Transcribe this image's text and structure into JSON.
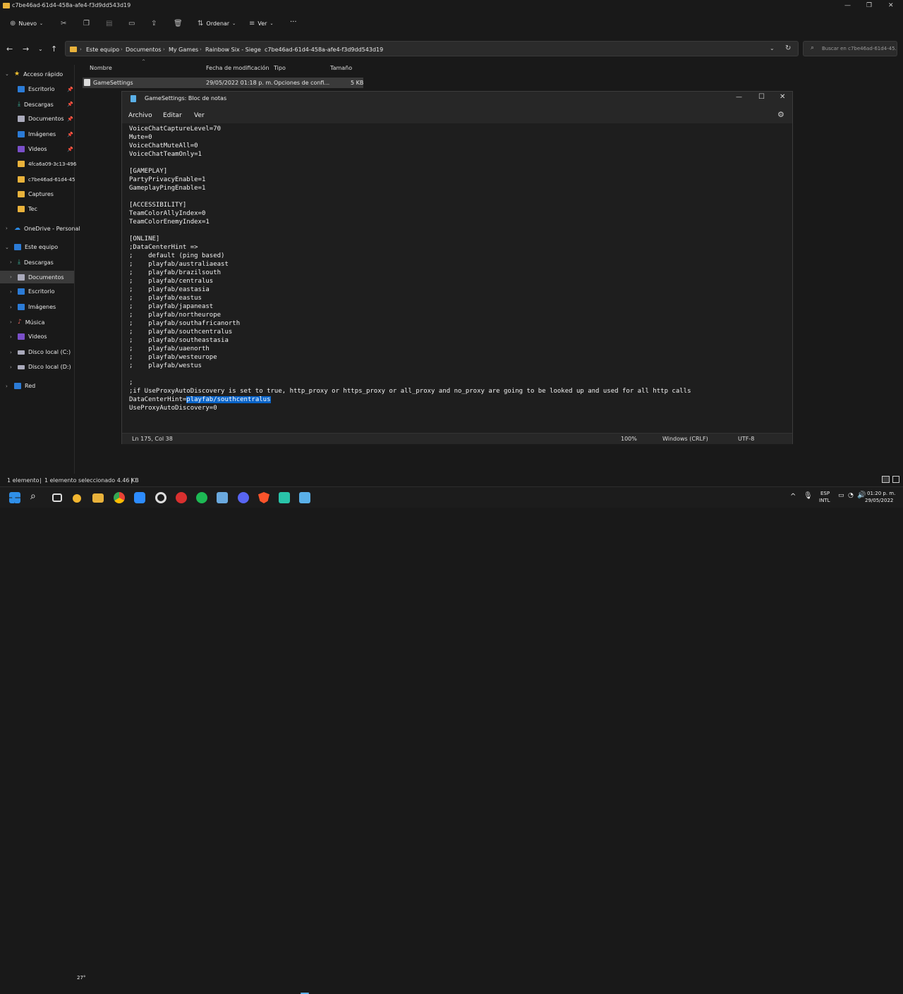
{
  "window": {
    "title": "c7be46ad-61d4-458a-afe4-f3d9dd543d19"
  },
  "toolbar": {
    "new_label": "Nuevo",
    "sort_label": "Ordenar",
    "view_label": "Ver",
    "more_label": "···"
  },
  "address": {
    "breadcrumbs": [
      "Este equipo",
      "Documentos",
      "My Games",
      "Rainbow Six - Siege",
      "c7be46ad-61d4-458a-afe4-f3d9dd543d19"
    ],
    "search_placeholder": "Buscar en c7be46ad-61d4-45..."
  },
  "sidebar": {
    "quick_access": "Acceso rápido",
    "items": [
      "Escritorio",
      "Descargas",
      "Documentos",
      "Imágenes",
      "Videos",
      "4fca6a09-3c13-496",
      "c7be46ad-61d4-45",
      "Captures",
      "Tec"
    ],
    "onedrive": "OneDrive - Personal",
    "this_pc": "Este equipo",
    "pc_items": [
      "Descargas",
      "Documentos",
      "Escritorio",
      "Imágenes",
      "Música",
      "Videos",
      "Disco local (C:)",
      "Disco local (D:)"
    ],
    "network": "Red"
  },
  "columns": [
    "Nombre",
    "Fecha de modificación",
    "Tipo",
    "Tamaño"
  ],
  "file": {
    "name": "GameSettings",
    "modified": "29/05/2022 01:18 p. m.",
    "type": "Opciones de confi...",
    "size": "5 KB"
  },
  "notepad": {
    "title": "GameSettings: Bloc de notas",
    "menu": [
      "Archivo",
      "Editar",
      "Ver"
    ],
    "content_before": "VoiceChatCaptureLevel=70\nMute=0\nVoiceChatMuteAll=0\nVoiceChatTeamOnly=1\n\n[GAMEPLAY]\nPartyPrivacyEnable=1\nGameplayPingEnable=1\n\n[ACCESSIBILITY]\nTeamColorAllyIndex=0\nTeamColorEnemyIndex=1\n\n[ONLINE]\n;DataCenterHint =>\n;    default (ping based)\n;    playfab/australiaeast\n;    playfab/brazilsouth\n;    playfab/centralus\n;    playfab/eastasia\n;    playfab/eastus\n;    playfab/japaneast\n;    playfab/northeurope\n;    playfab/southafricanorth\n;    playfab/southcentralus\n;    playfab/southeastasia\n;    playfab/uaenorth\n;    playfab/westeurope\n;    playfab/westus\n\n;\n;if UseProxyAutoDiscovery is set to true, http_proxy or https_proxy or all_proxy and no_proxy are going to be looked up and used for all http calls\nDataCenterHint=",
    "content_selected": "playfab/southcentralus",
    "content_after": "\nUseProxyAutoDiscovery=0",
    "status": {
      "position": "Ln 175, Col 38",
      "zoom": "100%",
      "eol": "Windows (CRLF)",
      "encoding": "UTF-8"
    }
  },
  "explorer_status": {
    "count": "1 elemento",
    "selected": "1 elemento seleccionado  4.46 KB"
  },
  "tray": {
    "temp": "27°",
    "lang": "ESP",
    "layout": "INTL",
    "time": "01:20 p. m.",
    "date": "29/05/2022"
  }
}
